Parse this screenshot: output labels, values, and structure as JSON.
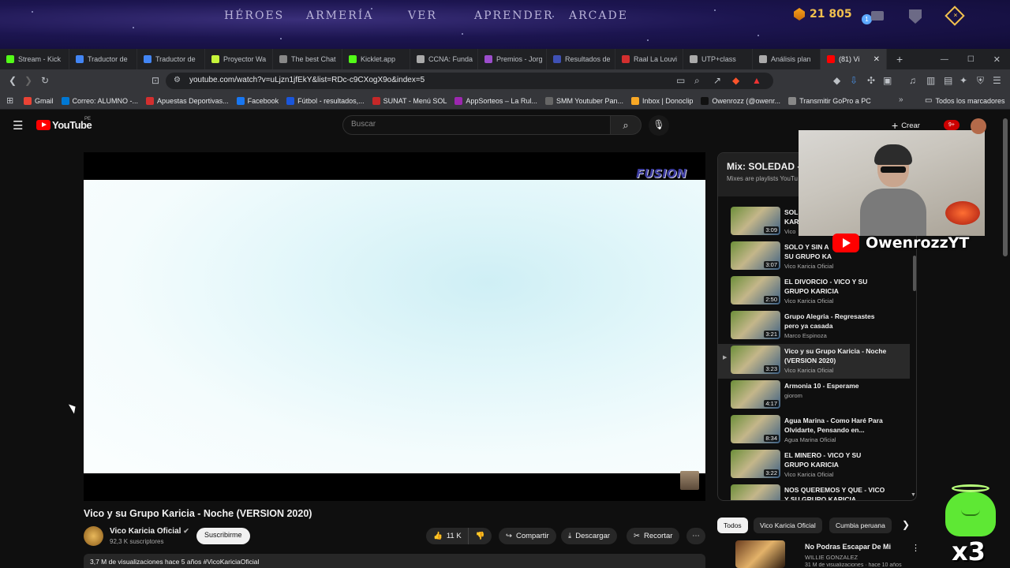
{
  "game": {
    "nav": [
      "HÉROES",
      "ARMERÍA",
      "VER",
      "APRENDER",
      "ARCADE"
    ],
    "coins": "21 805",
    "badge": "1"
  },
  "browser": {
    "tabs": [
      {
        "label": "Stream - Kick",
        "color": "#53fc18"
      },
      {
        "label": "Traductor de",
        "color": "#4285f4"
      },
      {
        "label": "Traductor de",
        "color": "#4285f4"
      },
      {
        "label": "Proyector Wa",
        "color": "#c6f53a"
      },
      {
        "label": "The best Chat",
        "color": "#888888"
      },
      {
        "label": "Kicklet.app",
        "color": "#53fc18"
      },
      {
        "label": "CCNA: Funda",
        "color": "#aaaaaa"
      },
      {
        "label": "Premios - Jorg",
        "color": "#9c4dcc"
      },
      {
        "label": "Resultados de",
        "color": "#3f51b5"
      },
      {
        "label": "Raal La Louvi",
        "color": "#d32f2f"
      },
      {
        "label": "UTP+class",
        "color": "#aaaaaa"
      },
      {
        "label": "Análisis plan",
        "color": "#aaaaaa"
      },
      {
        "label": "(81) Vi",
        "color": "#ff0000"
      }
    ],
    "url": "youtube.com/watch?v=uLjzn1jfEkY&list=RDc-c9CXogX9o&index=5",
    "bookmarks": [
      {
        "label": "Gmail",
        "color": "#ea4335"
      },
      {
        "label": "Correo: ALUMNO -...",
        "color": "#0078d4"
      },
      {
        "label": "Apuestas Deportivas...",
        "color": "#d32f2f"
      },
      {
        "label": "Facebook",
        "color": "#1877f2"
      },
      {
        "label": "Fútbol - resultados,...",
        "color": "#1a56db"
      },
      {
        "label": "SUNAT - Menú SOL",
        "color": "#c62828"
      },
      {
        "label": "AppSorteos – La Rul...",
        "color": "#9c27b0"
      },
      {
        "label": "SMM Youtuber Pan...",
        "color": "#666666"
      },
      {
        "label": "Inbox | Donoclip",
        "color": "#f9a825"
      },
      {
        "label": "Owenrozz (@owenr...",
        "color": "#111111"
      },
      {
        "label": "Transmitir GoPro a PC",
        "color": "#888888"
      }
    ],
    "all_bookmarks": "Todos los marcadores"
  },
  "youtube": {
    "logo_text": "YouTube",
    "region": "PE",
    "search_placeholder": "Buscar",
    "create_label": "Crear",
    "notifications": "9+",
    "player_watermark": "FUSION",
    "video_title": "Vico y su Grupo Karicia - Noche (VERSION 2020)",
    "channel": "Vico Karicia Oficial",
    "subscribers": "92,3 K suscriptores",
    "subscribe_label": "Suscribirme",
    "likes": "11 K",
    "share_label": "Compartir",
    "download_label": "Descargar",
    "clip_label": "Recortar",
    "views_line": "3,7 M de visualizaciones  hace 5 años  #VicoKariciaOficial"
  },
  "playlist": {
    "title": "Mix: SOLEDAD -",
    "subtitle": "Mixes are playlists YouTu",
    "items": [
      {
        "title": "SOL KAR",
        "channel": "Vico",
        "duration": "3:09",
        "active": false
      },
      {
        "title": "SOLO Y SIN A SU GRUPO KA",
        "channel": "Vico Karicia Oficial",
        "duration": "3:07",
        "active": false
      },
      {
        "title": "EL DIVORCIO - VICO Y SU GRUPO KARICIA",
        "channel": "Vico Karicia Oficial",
        "duration": "2:50",
        "active": false
      },
      {
        "title": "Grupo Alegria - Regresastes pero ya casada",
        "channel": "Marco Espinoza",
        "duration": "3:21",
        "active": false
      },
      {
        "title": "Vico y su Grupo Karicia - Noche (VERSION 2020)",
        "channel": "Vico Karicia Oficial",
        "duration": "3:23",
        "active": true
      },
      {
        "title": "Armonia 10 - Esperame",
        "channel": "giorom",
        "duration": "4:17",
        "active": false
      },
      {
        "title": "Agua Marina - Como Haré Para Olvidarte, Pensando en...",
        "channel": "Agua Marina Oficial",
        "duration": "8:34",
        "active": false
      },
      {
        "title": "EL MINERO - VICO Y SU GRUPO KARICIA",
        "channel": "Vico Karicia Oficial",
        "duration": "3:22",
        "active": false
      },
      {
        "title": "NOS QUEREMOS Y QUE - VICO Y SU GRUPO KARICIA",
        "channel": "",
        "duration": "",
        "active": false
      }
    ],
    "chips": [
      "Todos",
      "Vico Karicia Oficial",
      "Cumbia peruana"
    ]
  },
  "recommended": {
    "title": "No Podras Escapar De Mi",
    "channel": "WILLIE GONZALEZ",
    "meta": "31 M de visualizaciones · hace 10 años"
  },
  "overlay": {
    "streamer": "OwenrozzYT",
    "multiplier": "x3"
  }
}
